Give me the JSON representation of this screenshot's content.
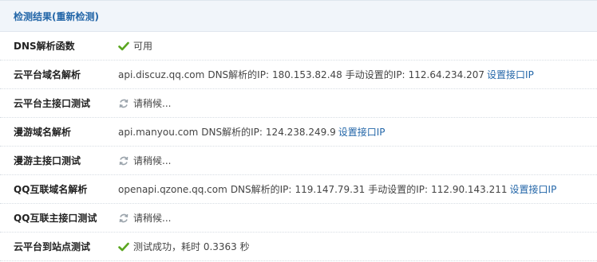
{
  "header": {
    "title": "检测结果(重新检测)"
  },
  "rows": [
    {
      "label": "DNS解析函数",
      "status": "可用"
    },
    {
      "label": "云平台域名解析",
      "domain": "api.discuz.qq.com",
      "dns_label": "DNS解析的IP:",
      "dns_ip": "180.153.82.48",
      "manual_label": "手动设置的IP:",
      "manual_ip": "112.64.234.207",
      "link": "设置接口IP"
    },
    {
      "label": "云平台主接口测试",
      "status": "请稍候..."
    },
    {
      "label": "漫游域名解析",
      "domain": "api.manyou.com",
      "dns_label": "DNS解析的IP:",
      "dns_ip": "124.238.249.9",
      "link": "设置接口IP"
    },
    {
      "label": "漫游主接口测试",
      "status": "请稍候..."
    },
    {
      "label": "QQ互联域名解析",
      "domain": "openapi.qzone.qq.com",
      "dns_label": "DNS解析的IP:",
      "dns_ip": "119.147.79.31",
      "manual_label": "手动设置的IP:",
      "manual_ip": "112.90.143.211",
      "link": "设置接口IP"
    },
    {
      "label": "QQ互联主接口测试",
      "status": "请稍候..."
    },
    {
      "label": "云平台到站点测试",
      "status": "测试成功，耗时 0.3363 秒"
    }
  ],
  "icons": {
    "check": "check-icon",
    "loading": "loading-icon"
  },
  "colors": {
    "header_bg": "#f1f5fa",
    "header_text": "#2366a8",
    "link": "#2366a8",
    "check": "#5aa61f",
    "loading": "#9aa3ab"
  }
}
